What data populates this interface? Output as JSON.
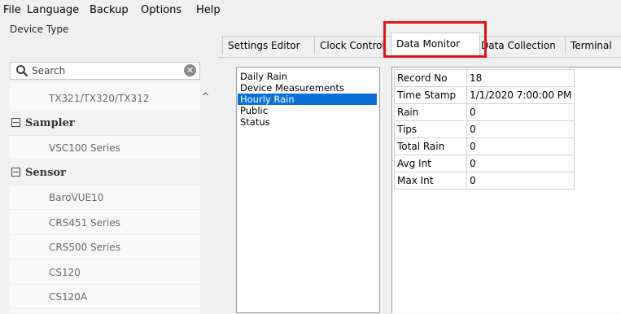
{
  "menu": [
    "File",
    "Language",
    "Backup",
    "Options",
    "Help"
  ],
  "sidebar": {
    "title": "Device Type",
    "search_placeholder": "Search",
    "items": [
      {
        "kind": "leaf",
        "label": "TX321/TX320/TX312"
      },
      {
        "kind": "group",
        "label": "Sampler"
      },
      {
        "kind": "leaf",
        "label": "VSC100 Series"
      },
      {
        "kind": "group",
        "label": "Sensor"
      },
      {
        "kind": "leaf",
        "label": "BaroVUE10"
      },
      {
        "kind": "leaf",
        "label": "CRS451 Series"
      },
      {
        "kind": "leaf",
        "label": "CRS500 Series"
      },
      {
        "kind": "leaf",
        "label": "CS120"
      },
      {
        "kind": "leaf",
        "label": "CS120A"
      }
    ]
  },
  "tabs": [
    {
      "label": "Settings Editor",
      "active": false
    },
    {
      "label": "Clock Control",
      "active": false
    },
    {
      "label": "Data Monitor",
      "active": true
    },
    {
      "label": "Data Collection",
      "active": false
    },
    {
      "label": "Terminal",
      "active": false
    }
  ],
  "tables": {
    "items": [
      "Daily Rain",
      "Device Measurements",
      "Hourly Rain",
      "Public",
      "Status"
    ],
    "selected": "Hourly Rain"
  },
  "data_rows": [
    {
      "name": "Record No",
      "value": "18"
    },
    {
      "name": "Time Stamp",
      "value": "1/1/2020 7:00:00 PM"
    },
    {
      "name": "Rain",
      "value": "0"
    },
    {
      "name": "Tips",
      "value": "0"
    },
    {
      "name": "Total Rain",
      "value": "0"
    },
    {
      "name": "Avg Int",
      "value": "0"
    },
    {
      "name": "Max Int",
      "value": "0"
    }
  ],
  "colors": {
    "selection": "#0a6fd6",
    "highlight": "#e0141a"
  }
}
